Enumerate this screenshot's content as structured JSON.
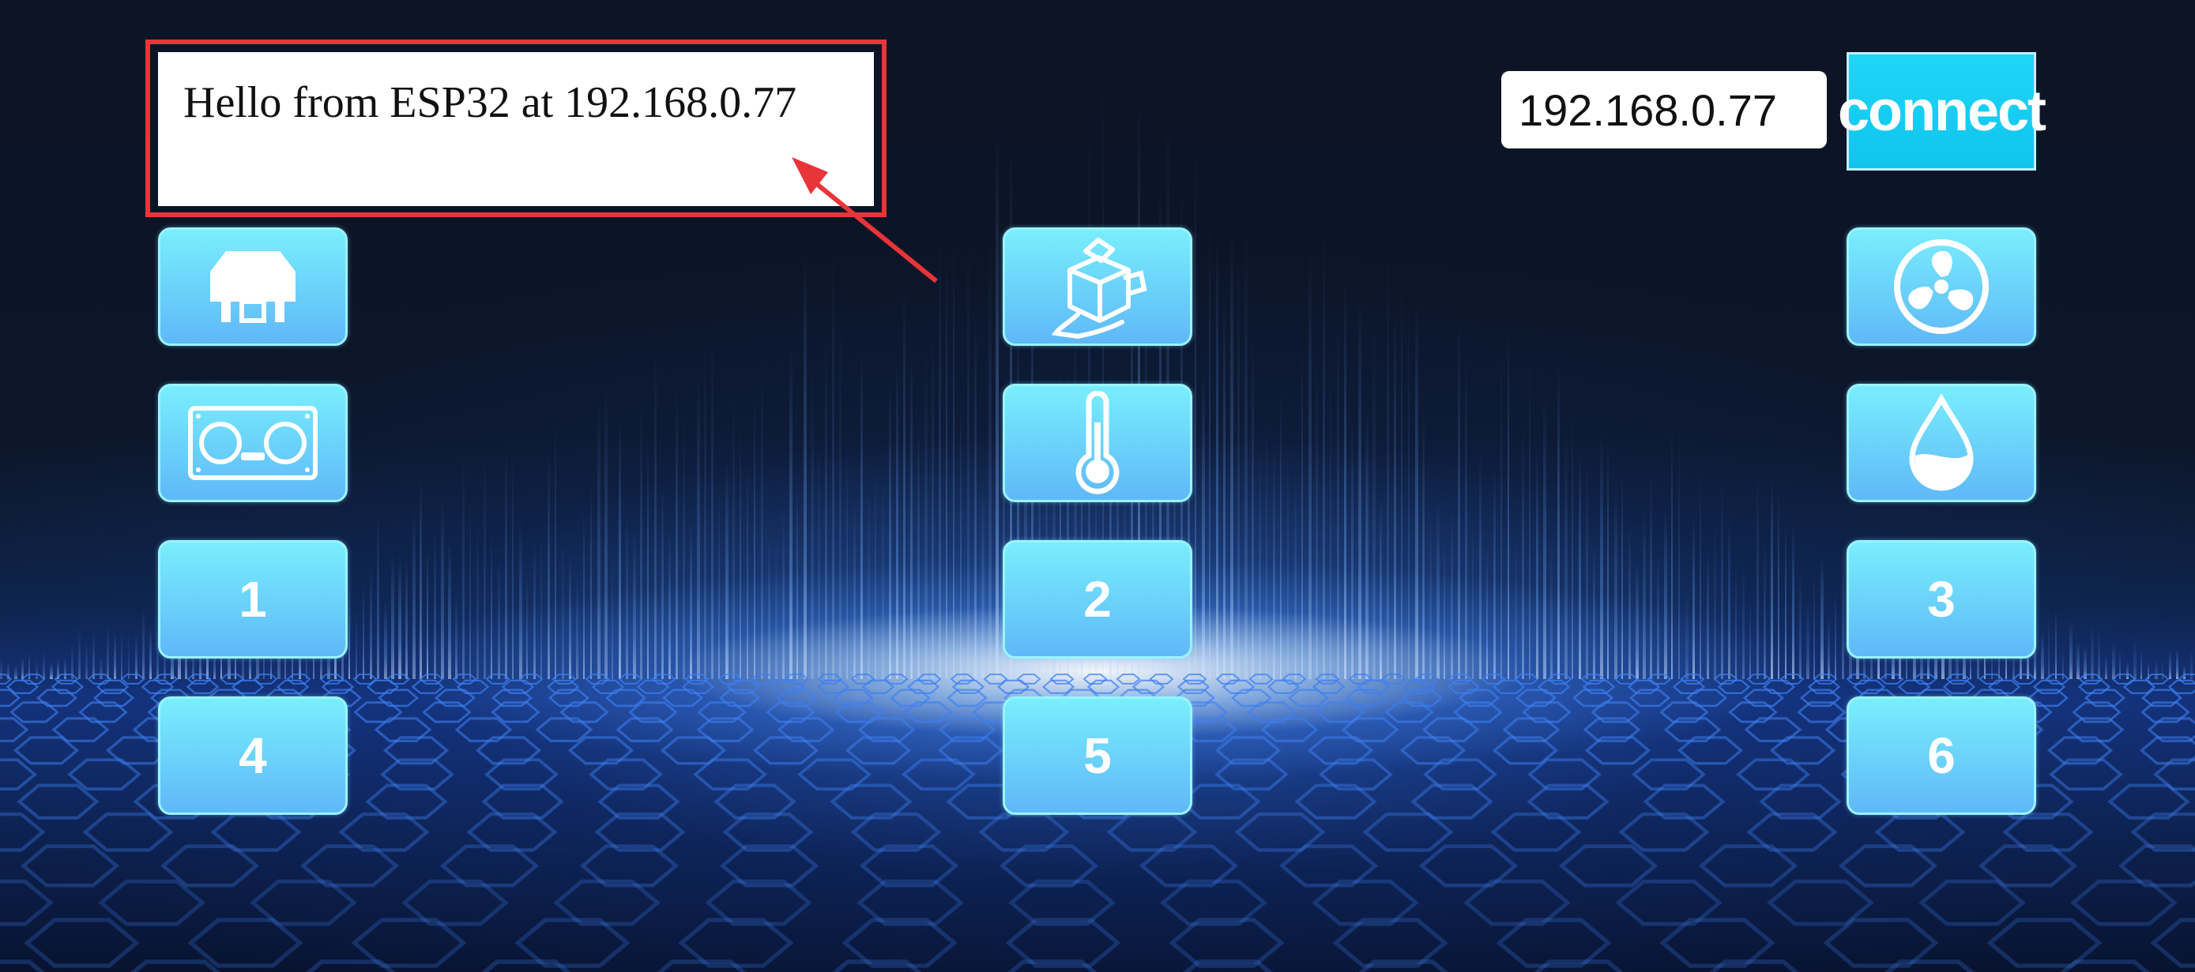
{
  "message": {
    "text": "Hello from ESP32 at 192.168.0.77"
  },
  "connection": {
    "ip_value": "192.168.0.77",
    "connect_label": "connect"
  },
  "controls": {
    "left_column": [
      {
        "icon": "relay-module-icon"
      },
      {
        "icon": "ultrasonic-sensor-icon"
      },
      {
        "label": "1"
      },
      {
        "label": "4"
      }
    ],
    "middle_column": [
      {
        "icon": "servo-motor-icon"
      },
      {
        "icon": "thermometer-icon"
      },
      {
        "label": "2"
      },
      {
        "label": "5"
      }
    ],
    "right_column": [
      {
        "icon": "fan-icon"
      },
      {
        "icon": "water-drop-icon"
      },
      {
        "label": "3"
      },
      {
        "label": "6"
      }
    ]
  },
  "colors": {
    "highlight_border": "#e8353a",
    "annotation_arrow": "#e8353a",
    "tile_gradient_top": "#79eefd",
    "tile_gradient_bottom": "#5fb8f8",
    "connect_button": "#10c4ee",
    "background_dark": "#0b1222"
  }
}
